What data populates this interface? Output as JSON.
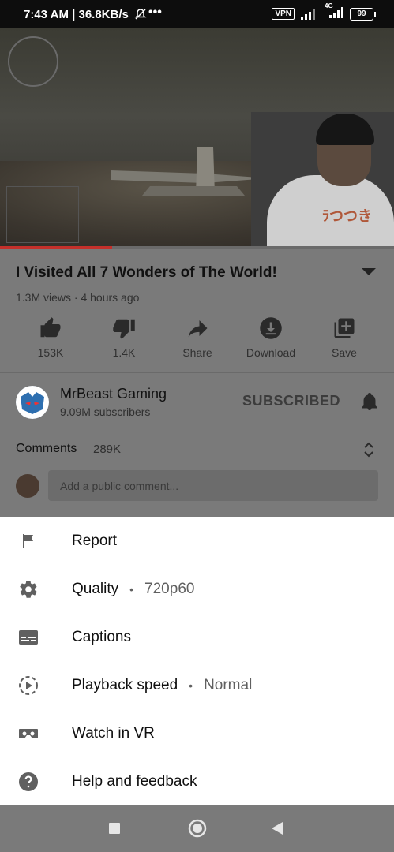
{
  "status": {
    "time": "7:43 AM | 36.8KB/s",
    "vpn": "VPN",
    "network": "4G",
    "battery": "99"
  },
  "video": {
    "title": "I Visited All 7 Wonders of The World!",
    "views": "1.3M views",
    "age": "4 hours ago",
    "meta": "1.3M views · 4 hours ago",
    "progress": 0.285
  },
  "actions": [
    {
      "label": "153K",
      "icon": "thumbs-up-icon"
    },
    {
      "label": "1.4K",
      "icon": "thumbs-down-icon"
    },
    {
      "label": "Share",
      "icon": "share-icon"
    },
    {
      "label": "Download",
      "icon": "download-icon"
    },
    {
      "label": "Save",
      "icon": "save-playlist-icon"
    }
  ],
  "channel": {
    "name": "MrBeast Gaming",
    "subscribers": "9.09M subscribers",
    "subscribe_state": "SUBSCRIBED"
  },
  "comments": {
    "label": "Comments",
    "count": "289K",
    "placeholder": "Add a public comment..."
  },
  "menu": {
    "items": [
      {
        "label": "Report",
        "icon": "flag-icon"
      },
      {
        "label": "Quality",
        "value": "720p60",
        "icon": "gear-icon"
      },
      {
        "label": "Captions",
        "icon": "captions-icon"
      },
      {
        "label": "Playback speed",
        "value": "Normal",
        "icon": "playback-speed-icon"
      },
      {
        "label": "Watch in VR",
        "icon": "vr-icon"
      },
      {
        "label": "Help and feedback",
        "icon": "help-icon"
      }
    ],
    "separator": "•"
  },
  "colors": {
    "progress": "#c4302b",
    "sheet": "#ffffff",
    "overlay": "#7a7a7a"
  }
}
